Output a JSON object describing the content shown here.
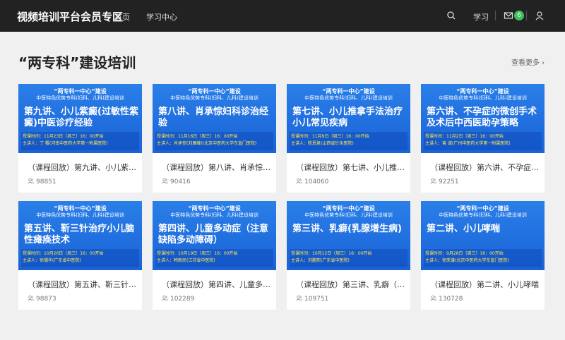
{
  "header": {
    "brand": "视频培训平台会员专区",
    "nav": [
      "首页",
      "学习中心"
    ],
    "learn_label": "学习",
    "mail_count": "6"
  },
  "section": {
    "title": "“两专科”建设培训",
    "more": "查看更多 ›"
  },
  "thumb_common": {
    "line1": "“两专科一中心”建设",
    "line2": "中医特色优势专科(妇科、儿科)建设培训"
  },
  "courses": [
    {
      "thumb_title": "第九讲、小儿紫癜(过敏性紫癜)中医诊疗经验",
      "time": "授课时间：11月23日（周三）16：00开始",
      "speaker": "主讲人：丁 樱(河南中医药大学第一附属医院)",
      "title": "（课程回放）第九讲、小儿紫癜（过敏性紫癜）中医诊疗经验",
      "views": "98851"
    },
    {
      "thumb_title": "第八讲、肖承悰妇科诊治经验",
      "time": "授课时间：11月16日（周三）16：00开始",
      "speaker": "主讲人：肖承悰(刘雁峰)(北京中医药大学东直门医院)",
      "title": "（课程回放）第八讲、肖承悰妇科诊治经验",
      "views": "90416"
    },
    {
      "thumb_title": "第七讲、小儿推拿手法治疗小儿常见疾病",
      "time": "授课时间：11月9日（周三）16：00开始",
      "speaker": "主讲人：陈恩泉(山西省针灸医院)",
      "title": "（课程回放）第七讲、小儿推拿手法治疗小儿常见疾病",
      "views": "104060"
    },
    {
      "thumb_title": "第六讲、不孕症的微创手术及术后中西医助孕策略",
      "time": "授课时间：11月2日（周三）16：00开始",
      "speaker": "主讲人：曾 诚(广州中医药大学第一附属医院)",
      "title": "（课程回放）第六讲、不孕症的微创手术及术后中西医助孕策略",
      "views": "92251"
    },
    {
      "thumb_title": "第五讲、靳三针治疗小儿脑性瘫痪技术",
      "time": "授课时间：10月26日（周三）16：00开始",
      "speaker": "主讲人：徐珊华(广东省中医院)",
      "title": "（课程回放）第五讲、靳三针治疗小儿脑性瘫痪技术",
      "views": "98873"
    },
    {
      "thumb_title": "第四讲、儿童多动症（注意缺陷多动障碍）",
      "time": "授课时间：10月19日（周三）16：00开始",
      "speaker": "主讲人：韩新民(江苏省中医院)",
      "title": "（课程回放）第四讲、儿童多动症（注意缺陷多动障碍）",
      "views": "102289"
    },
    {
      "thumb_title": "第三讲、乳癖(乳腺增生病)",
      "time": "授课时间：10月12日（周三）16：00开始",
      "speaker": "主讲人：刘鹏熙(广东省中医院)",
      "title": "（课程回放）第三讲、乳癖（乳腺增生病）",
      "views": "109751"
    },
    {
      "thumb_title": "第二讲、小儿哮喘",
      "time": "授课时间：9月28日（周三）16：00开始",
      "speaker": "主讲人：徐荣谦(北京中医药大学东直门医院)",
      "title": "（课程回放）第二讲、小儿哮喘",
      "views": "130728"
    }
  ]
}
